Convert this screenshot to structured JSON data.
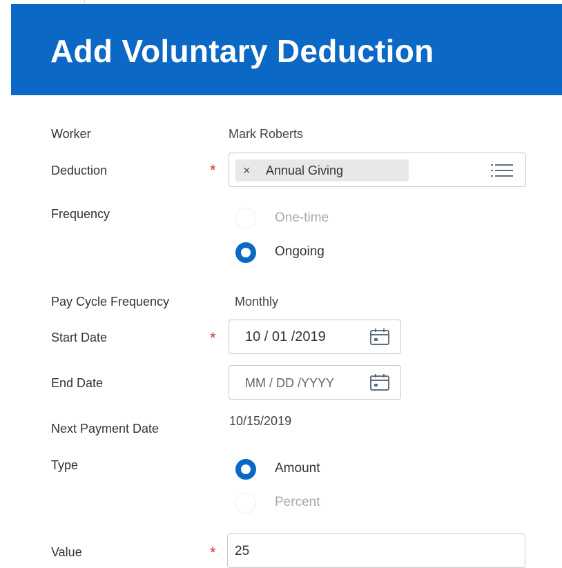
{
  "header": {
    "title": "Add Voluntary Deduction"
  },
  "colors": {
    "header_bg": "#0c68c5",
    "required": "#d22d2d",
    "radio_selected": "#0c68c5"
  },
  "form": {
    "worker": {
      "label": "Worker",
      "value": "Mark Roberts"
    },
    "deduction": {
      "label": "Deduction",
      "required_mark": "*",
      "selected": "Annual Giving",
      "remove_icon": "×",
      "prompt_icon": "list-icon"
    },
    "frequency": {
      "label": "Frequency",
      "options": [
        {
          "label": "One-time",
          "selected": false
        },
        {
          "label": "Ongoing",
          "selected": true
        }
      ]
    },
    "pay_cycle_frequency": {
      "label": "Pay Cycle Frequency",
      "value": "Monthly"
    },
    "start_date": {
      "label": "Start Date",
      "required_mark": "*",
      "value": "10 / 01 /2019",
      "icon": "calendar-icon"
    },
    "end_date": {
      "label": "End Date",
      "placeholder": "MM / DD /YYYY",
      "icon": "calendar-icon"
    },
    "next_payment_date": {
      "label": "Next Payment Date",
      "value": "10/15/2019"
    },
    "type": {
      "label": "Type",
      "options": [
        {
          "label": "Amount",
          "selected": true
        },
        {
          "label": "Percent",
          "selected": false
        }
      ]
    },
    "value": {
      "label": "Value",
      "required_mark": "*",
      "value": "25"
    }
  }
}
